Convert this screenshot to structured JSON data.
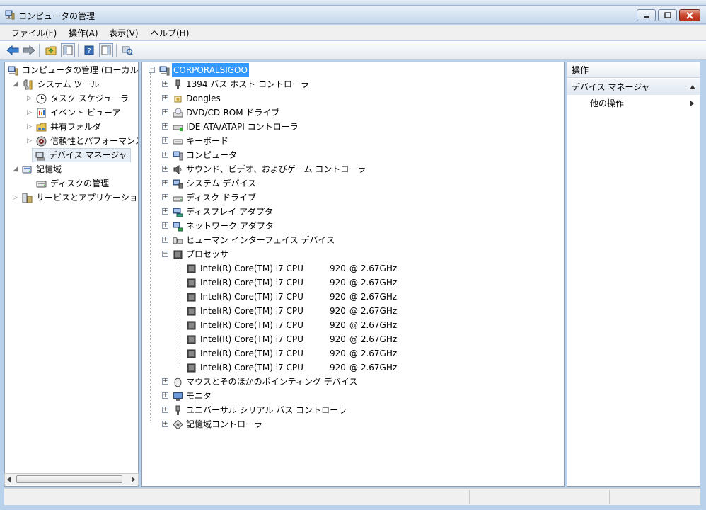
{
  "window": {
    "title": "コンピュータの管理"
  },
  "menu": [
    {
      "label": "ファイル(F)"
    },
    {
      "label": "操作(A)"
    },
    {
      "label": "表示(V)"
    },
    {
      "label": "ヘルプ(H)"
    }
  ],
  "toolbar": {
    "icons": [
      "back-arrow-icon",
      "forward-arrow-icon",
      "up-folder-icon",
      "show-hide-tree-icon",
      "help-icon",
      "show-hide-action-pane-icon",
      "scan-hardware-icon"
    ]
  },
  "left_tree": {
    "root": "コンピュータの管理 (ローカル",
    "system_tools": "システム ツール",
    "task_scheduler": "タスク スケジューラ",
    "event_viewer": "イベント ビューア",
    "shared_folders": "共有フォルダ",
    "reliability": "信頼性とパフォーマンス",
    "device_manager": "デバイス マネージャ",
    "storage": "記憶域",
    "disk_management": "ディスクの管理",
    "services_apps": "サービスとアプリケーション"
  },
  "devices": {
    "root": "CORPORALSIGOO",
    "categories_before": [
      {
        "label": "1394 バス ホスト コントローラ",
        "icon": "firewire-icon"
      },
      {
        "label": "Dongles",
        "icon": "dongle-icon"
      },
      {
        "label": "DVD/CD-ROM ドライブ",
        "icon": "dvd-drive-icon"
      },
      {
        "label": "IDE ATA/ATAPI コントローラ",
        "icon": "ide-controller-icon"
      },
      {
        "label": "キーボード",
        "icon": "keyboard-icon"
      },
      {
        "label": "コンピュータ",
        "icon": "computer-icon"
      },
      {
        "label": "サウンド、ビデオ、およびゲーム コントローラ",
        "icon": "speaker-icon"
      },
      {
        "label": "システム デバイス",
        "icon": "system-device-icon"
      },
      {
        "label": "ディスク ドライブ",
        "icon": "disk-drive-icon"
      },
      {
        "label": "ディスプレイ アダプタ",
        "icon": "display-adapter-icon"
      },
      {
        "label": "ネットワーク アダプタ",
        "icon": "network-adapter-icon"
      },
      {
        "label": "ヒューマン インターフェイス デバイス",
        "icon": "hid-icon"
      }
    ],
    "processor_category": "プロセッサ",
    "processors": [
      {
        "name": "Intel(R) Core(TM) i7 CPU",
        "model": "920",
        "speed": "@ 2.67GHz"
      },
      {
        "name": "Intel(R) Core(TM) i7 CPU",
        "model": "920",
        "speed": "@ 2.67GHz"
      },
      {
        "name": "Intel(R) Core(TM) i7 CPU",
        "model": "920",
        "speed": "@ 2.67GHz"
      },
      {
        "name": "Intel(R) Core(TM) i7 CPU",
        "model": "920",
        "speed": "@ 2.67GHz"
      },
      {
        "name": "Intel(R) Core(TM) i7 CPU",
        "model": "920",
        "speed": "@ 2.67GHz"
      },
      {
        "name": "Intel(R) Core(TM) i7 CPU",
        "model": "920",
        "speed": "@ 2.67GHz"
      },
      {
        "name": "Intel(R) Core(TM) i7 CPU",
        "model": "920",
        "speed": "@ 2.67GHz"
      },
      {
        "name": "Intel(R) Core(TM) i7 CPU",
        "model": "920",
        "speed": "@ 2.67GHz"
      }
    ],
    "categories_after": [
      {
        "label": "マウスとそのほかのポインティング デバイス",
        "icon": "mouse-icon"
      },
      {
        "label": "モニタ",
        "icon": "monitor-icon"
      },
      {
        "label": "ユニバーサル シリアル バス コントローラ",
        "icon": "usb-icon"
      },
      {
        "label": "記憶域コントローラ",
        "icon": "storage-controller-icon"
      }
    ]
  },
  "actions": {
    "header": "操作",
    "section": "デバイス マネージャ",
    "item": "他の操作"
  },
  "colors": {
    "selection": "#3399ff",
    "frame": "#b9d1ea"
  }
}
